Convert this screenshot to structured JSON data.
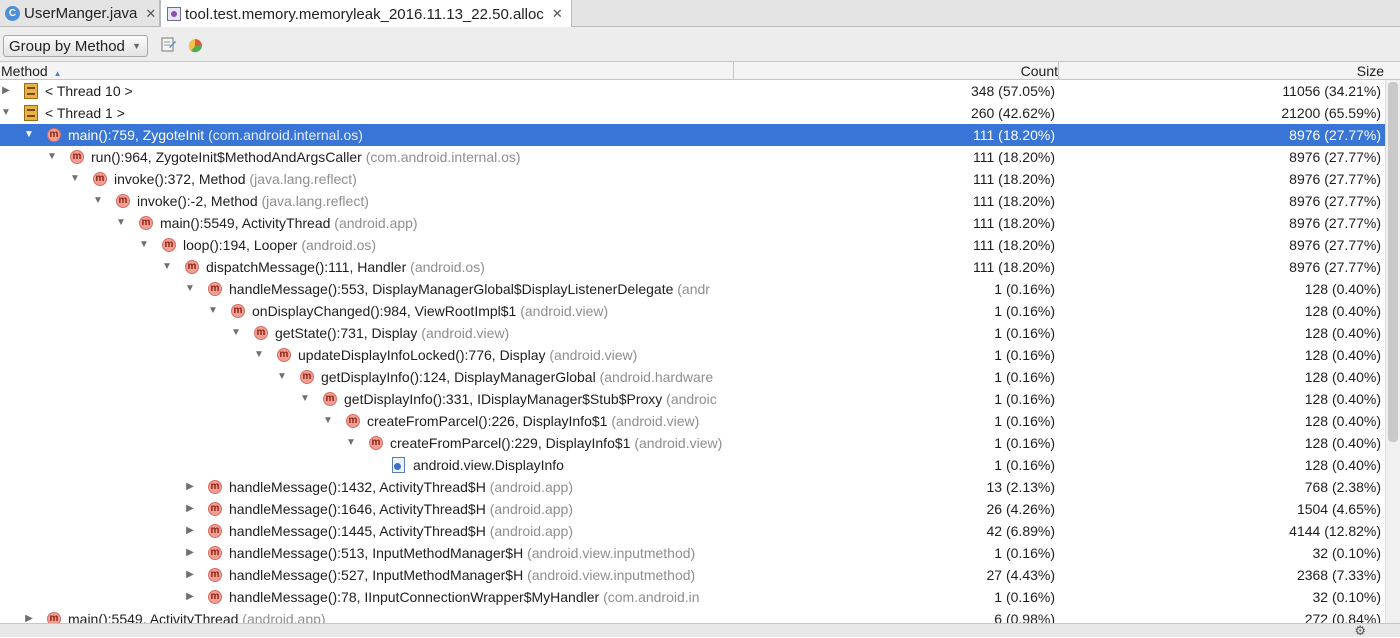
{
  "tabs": [
    {
      "label": "UserManger.java",
      "icon": "java-class-icon",
      "active": false
    },
    {
      "label": "tool.test.memory.memoryleak_2016.11.13_22.50.alloc",
      "icon": "alloc-file-icon",
      "active": true
    }
  ],
  "toolbar": {
    "group_by": "Group by Method",
    "icons": [
      "export-icon",
      "pie-chart-icon"
    ]
  },
  "columns": {
    "method": "Method",
    "count": "Count",
    "size": "Size"
  },
  "colors": {
    "selection": "#3875d7",
    "package_text": "#8e8e8e",
    "method_icon": "#f19f94"
  },
  "rows": [
    {
      "depth": 0,
      "expand": "collapsed",
      "icon": "thread-icon",
      "label": "< Thread 10 >",
      "pkg": "",
      "count": "348 (57.05%)",
      "size": "11056 (34.21%)"
    },
    {
      "depth": 0,
      "expand": "expanded",
      "icon": "thread-icon",
      "label": "< Thread 1 >",
      "pkg": "",
      "count": "260 (42.62%)",
      "size": "21200 (65.59%)"
    },
    {
      "depth": 1,
      "expand": "expanded",
      "icon": "method-icon",
      "label": "main():759, ZygoteInit",
      "pkg": "(com.android.internal.os)",
      "count": "111 (18.20%)",
      "size": "8976 (27.77%)",
      "selected": true
    },
    {
      "depth": 2,
      "expand": "expanded",
      "icon": "method-icon",
      "label": "run():964, ZygoteInit$MethodAndArgsCaller",
      "pkg": "(com.android.internal.os)",
      "count": "111 (18.20%)",
      "size": "8976 (27.77%)"
    },
    {
      "depth": 3,
      "expand": "expanded",
      "icon": "method-icon",
      "label": "invoke():372, Method",
      "pkg": "(java.lang.reflect)",
      "count": "111 (18.20%)",
      "size": "8976 (27.77%)"
    },
    {
      "depth": 4,
      "expand": "expanded",
      "icon": "method-icon",
      "label": "invoke():-2, Method",
      "pkg": "(java.lang.reflect)",
      "count": "111 (18.20%)",
      "size": "8976 (27.77%)"
    },
    {
      "depth": 5,
      "expand": "expanded",
      "icon": "method-icon",
      "label": "main():5549, ActivityThread",
      "pkg": "(android.app)",
      "count": "111 (18.20%)",
      "size": "8976 (27.77%)"
    },
    {
      "depth": 6,
      "expand": "expanded",
      "icon": "method-icon",
      "label": "loop():194, Looper",
      "pkg": "(android.os)",
      "count": "111 (18.20%)",
      "size": "8976 (27.77%)"
    },
    {
      "depth": 7,
      "expand": "expanded",
      "icon": "method-icon",
      "label": "dispatchMessage():111, Handler",
      "pkg": "(android.os)",
      "count": "111 (18.20%)",
      "size": "8976 (27.77%)"
    },
    {
      "depth": 8,
      "expand": "expanded",
      "icon": "method-icon",
      "label": "handleMessage():553, DisplayManagerGlobal$DisplayListenerDelegate",
      "pkg": "(andr",
      "count": "1 (0.16%)",
      "size": "128 (0.40%)"
    },
    {
      "depth": 9,
      "expand": "expanded",
      "icon": "method-icon",
      "label": "onDisplayChanged():984, ViewRootImpl$1",
      "pkg": "(android.view)",
      "count": "1 (0.16%)",
      "size": "128 (0.40%)"
    },
    {
      "depth": 10,
      "expand": "expanded",
      "icon": "method-icon",
      "label": "getState():731, Display",
      "pkg": "(android.view)",
      "count": "1 (0.16%)",
      "size": "128 (0.40%)"
    },
    {
      "depth": 11,
      "expand": "expanded",
      "icon": "method-icon",
      "label": "updateDisplayInfoLocked():776, Display",
      "pkg": "(android.view)",
      "count": "1 (0.16%)",
      "size": "128 (0.40%)"
    },
    {
      "depth": 12,
      "expand": "expanded",
      "icon": "method-icon",
      "label": "getDisplayInfo():124, DisplayManagerGlobal",
      "pkg": "(android.hardware",
      "count": "1 (0.16%)",
      "size": "128 (0.40%)"
    },
    {
      "depth": 13,
      "expand": "expanded",
      "icon": "method-icon",
      "label": "getDisplayInfo():331, IDisplayManager$Stub$Proxy",
      "pkg": "(androic",
      "count": "1 (0.16%)",
      "size": "128 (0.40%)"
    },
    {
      "depth": 14,
      "expand": "expanded",
      "icon": "method-icon",
      "label": "createFromParcel():226, DisplayInfo$1",
      "pkg": "(android.view)",
      "count": "1 (0.16%)",
      "size": "128 (0.40%)"
    },
    {
      "depth": 15,
      "expand": "expanded",
      "icon": "method-icon",
      "label": "createFromParcel():229, DisplayInfo$1",
      "pkg": "(android.view)",
      "count": "1 (0.16%)",
      "size": "128 (0.40%)"
    },
    {
      "depth": 16,
      "expand": "none",
      "icon": "class-file-icon",
      "label": "android.view.DisplayInfo",
      "pkg": "",
      "count": "1 (0.16%)",
      "size": "128 (0.40%)"
    },
    {
      "depth": 8,
      "expand": "collapsed",
      "icon": "method-icon",
      "label": "handleMessage():1432, ActivityThread$H",
      "pkg": "(android.app)",
      "count": "13 (2.13%)",
      "size": "768 (2.38%)"
    },
    {
      "depth": 8,
      "expand": "collapsed",
      "icon": "method-icon",
      "label": "handleMessage():1646, ActivityThread$H",
      "pkg": "(android.app)",
      "count": "26 (4.26%)",
      "size": "1504 (4.65%)"
    },
    {
      "depth": 8,
      "expand": "collapsed",
      "icon": "method-icon",
      "label": "handleMessage():1445, ActivityThread$H",
      "pkg": "(android.app)",
      "count": "42 (6.89%)",
      "size": "4144 (12.82%)"
    },
    {
      "depth": 8,
      "expand": "collapsed",
      "icon": "method-icon",
      "label": "handleMessage():513, InputMethodManager$H",
      "pkg": "(android.view.inputmethod)",
      "count": "1 (0.16%)",
      "size": "32 (0.10%)"
    },
    {
      "depth": 8,
      "expand": "collapsed",
      "icon": "method-icon",
      "label": "handleMessage():527, InputMethodManager$H",
      "pkg": "(android.view.inputmethod)",
      "count": "27 (4.43%)",
      "size": "2368 (7.33%)"
    },
    {
      "depth": 8,
      "expand": "collapsed",
      "icon": "method-icon",
      "label": "handleMessage():78, IInputConnectionWrapper$MyHandler",
      "pkg": "(com.android.in",
      "count": "1 (0.16%)",
      "size": "32 (0.10%)"
    },
    {
      "depth": 1,
      "expand": "collapsed",
      "icon": "method-icon",
      "label": "main():5549, ActivityThread",
      "pkg": "(android.app)",
      "count": "6 (0.98%)",
      "size": "272 (0.84%)"
    }
  ]
}
